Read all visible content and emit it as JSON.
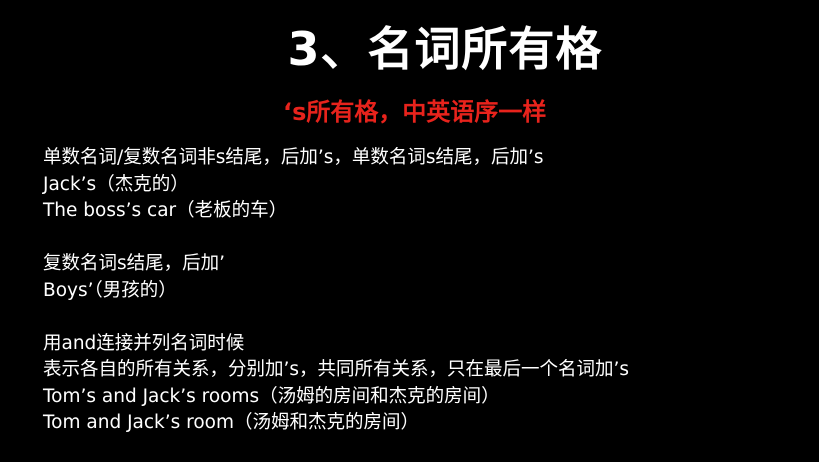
{
  "title": "3、名词所有格",
  "subtitle": "‘s所有格，中英语序一样",
  "colors": {
    "background": "#000000",
    "text": "#ffffff",
    "accent": "#e8231c"
  },
  "sections": [
    {
      "lines": [
        "单数名词/复数名词非s结尾，后加’s，单数名词s结尾，后加’s",
        "Jack’s（杰克的）",
        "The boss’s car（老板的车）"
      ]
    },
    {
      "lines": [
        "复数名词s结尾，后加’",
        "Boys’（男孩的）"
      ]
    },
    {
      "lines": [
        "用and连接并列名词时候",
        "表示各自的所有关系，分别加’s，共同所有关系，只在最后一个名词加’s",
        "Tom’s and Jack’s rooms（汤姆的房间和杰克的房间）",
        "Tom and Jack’s room（汤姆和杰克的房间）"
      ]
    }
  ]
}
